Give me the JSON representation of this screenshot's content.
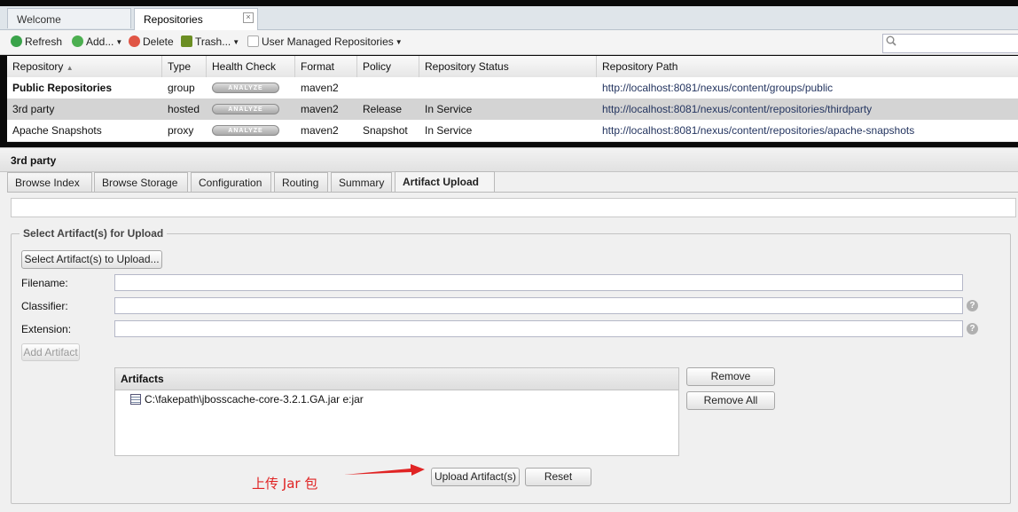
{
  "tabs": [
    {
      "label": "Welcome",
      "active": false
    },
    {
      "label": "Repositories",
      "active": true
    }
  ],
  "toolbar": {
    "refresh": "Refresh",
    "add": "Add...",
    "delete": "Delete",
    "trash": "Trash...",
    "user_managed": "User Managed Repositories",
    "search_placeholder": ""
  },
  "grid": {
    "columns": [
      "Repository",
      "Type",
      "Health Check",
      "Format",
      "Policy",
      "Repository Status",
      "Repository Path"
    ],
    "sort_column": "Repository",
    "sort_direction": "asc",
    "analyze_label": "ANALYZE",
    "rows": [
      {
        "name": "Public Repositories",
        "type": "group",
        "format": "maven2",
        "policy": "",
        "status": "",
        "path": "http://localhost:8081/nexus/content/groups/public",
        "bold": true,
        "selected": false
      },
      {
        "name": "3rd party",
        "type": "hosted",
        "format": "maven2",
        "policy": "Release",
        "status": "In Service",
        "path": "http://localhost:8081/nexus/content/repositories/thirdparty",
        "bold": false,
        "selected": true
      },
      {
        "name": "Apache Snapshots",
        "type": "proxy",
        "format": "maven2",
        "policy": "Snapshot",
        "status": "In Service",
        "path": "http://localhost:8081/nexus/content/repositories/apache-snapshots",
        "bold": false,
        "selected": false
      }
    ]
  },
  "detail": {
    "title": "3rd party",
    "tabs": [
      {
        "label": "Browse Index",
        "active": false
      },
      {
        "label": "Browse Storage",
        "active": false
      },
      {
        "label": "Configuration",
        "active": false
      },
      {
        "label": "Routing",
        "active": false
      },
      {
        "label": "Summary",
        "active": false
      },
      {
        "label": "Artifact Upload",
        "active": true
      }
    ]
  },
  "upload": {
    "legend": "Select Artifact(s) for Upload",
    "select_button": "Select Artifact(s) to Upload...",
    "filename_label": "Filename:",
    "filename_value": "",
    "classifier_label": "Classifier:",
    "classifier_value": "",
    "extension_label": "Extension:",
    "extension_value": "",
    "help_glyph": "?",
    "add_artifact_button": "Add Artifact",
    "artifacts_header": "Artifacts",
    "artifacts": [
      "C:\\fakepath\\jbosscache-core-3.2.1.GA.jar e:jar"
    ],
    "remove_button": "Remove",
    "remove_all_button": "Remove All",
    "upload_button": "Upload Artifact(s)",
    "reset_button": "Reset"
  },
  "annotation": {
    "text": "上传 Jar 包",
    "color": "#e02424"
  },
  "colors": {
    "selected_row": "#d4d4d4",
    "path_link": "#243560",
    "refresh_icon": "#3aa34a",
    "add_icon": "#4caf50",
    "delete_icon": "#e05545",
    "trash_icon": "#6b8e23"
  }
}
